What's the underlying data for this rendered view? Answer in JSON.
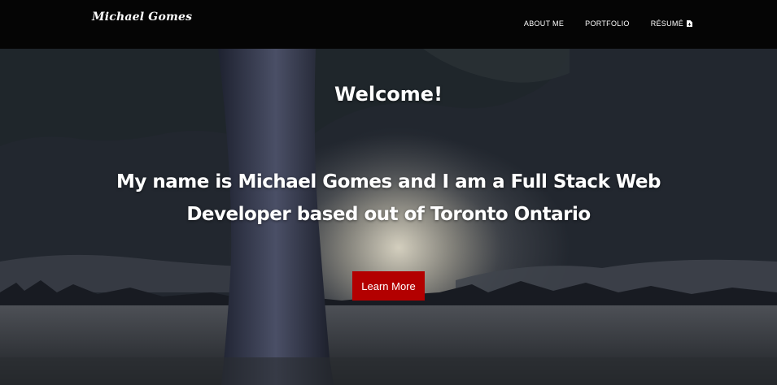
{
  "navbar": {
    "brand": "Michael Gomes",
    "links": [
      {
        "label": "ABOUT ME"
      },
      {
        "label": "PORTFOLIO"
      },
      {
        "label": "RÉSUMÉ",
        "icon": "file-download-icon"
      }
    ]
  },
  "hero": {
    "welcome": "Welcome!",
    "tagline": "My name is Michael Gomes and I am a Full Stack Web Developer based out of Toronto Ontario",
    "cta_label": "Learn More"
  },
  "colors": {
    "navbar_bg": "#050505",
    "cta_bg": "#b30000",
    "text": "#ffffff"
  }
}
